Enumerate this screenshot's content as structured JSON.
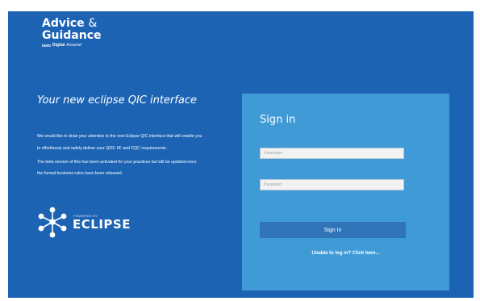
{
  "logo": {
    "line1": "Advice",
    "amp": "&",
    "line2": "Guidance",
    "sub_box": "EMIS",
    "sub_digital": "Digital",
    "sub_assured": "Assured"
  },
  "intro": {
    "headline": "Your new eclipse QIC interface",
    "para1_line1": "We would like to draw your attention to the new Eclipse QIC interface that will enable you",
    "para1_line2": "to effortlessly and safely deliver your QOF, IIF and CQC requirements.",
    "para2_line1": "The beta version of this has been activated for your practices but will be updated once",
    "para2_line2": "the formal business rules have been released."
  },
  "eclipse_logo": {
    "powered_by": "POWERED BY",
    "brand": "ECLIPSE"
  },
  "signin": {
    "title": "Sign in",
    "username_placeholder": "Username",
    "password_placeholder": "Password",
    "button_label": "Sign In",
    "help_link": "Unable to log in? Click here..."
  },
  "colors": {
    "background": "#1c63b3",
    "panel": "#3f9ad6",
    "button": "#2f74b7"
  }
}
